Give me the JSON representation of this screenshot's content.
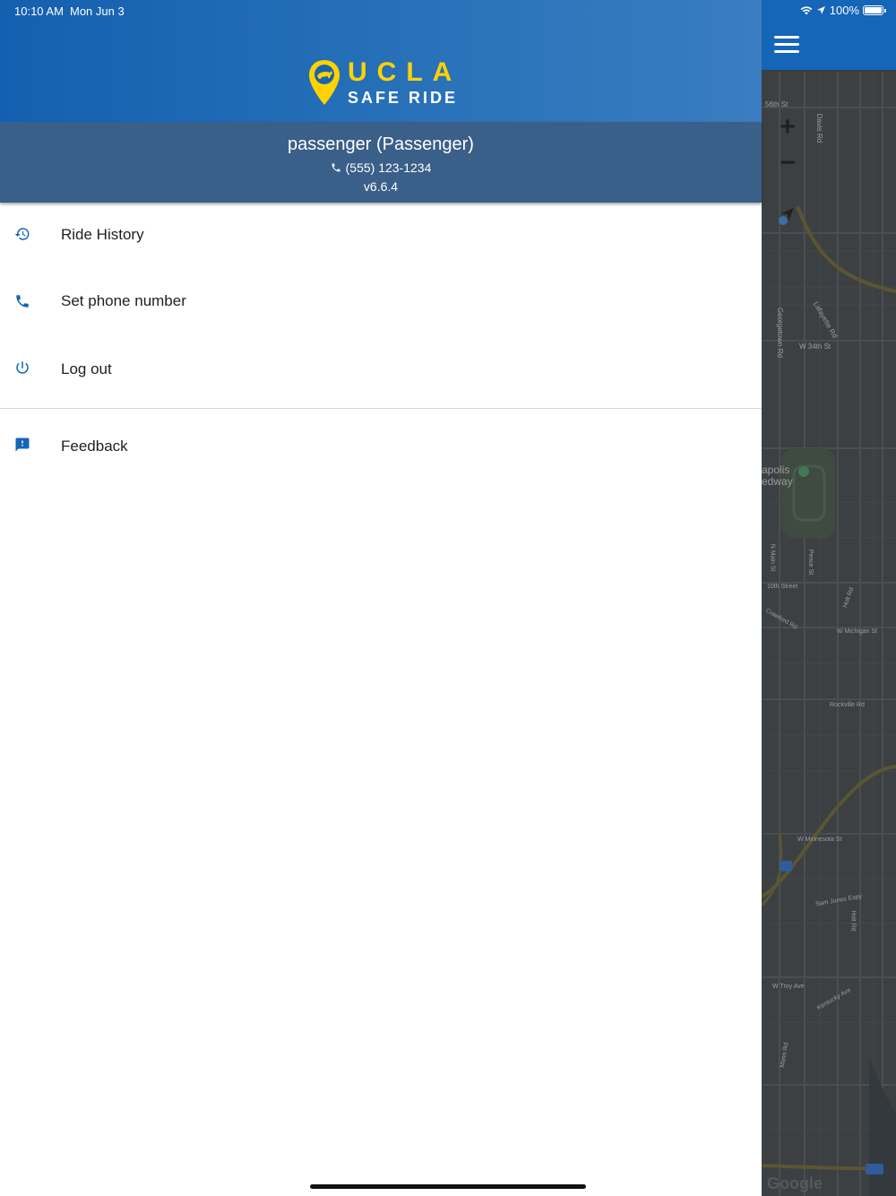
{
  "status_bar": {
    "time": "10:10 AM",
    "date": "Mon Jun 3",
    "battery": "100%"
  },
  "logo": {
    "title": "UCLA",
    "subtitle": "SAFE RIDE"
  },
  "user": {
    "name": "passenger (Passenger)",
    "phone": "(555) 123-1234",
    "version": "v6.6.4"
  },
  "menu": {
    "items": [
      {
        "label": "Ride History",
        "icon": "history-icon"
      },
      {
        "label": "Set phone number",
        "icon": "phone-icon"
      },
      {
        "label": "Log out",
        "icon": "power-icon"
      }
    ],
    "secondary": [
      {
        "label": "Feedback",
        "icon": "feedback-icon"
      }
    ]
  },
  "map": {
    "zoom_in": "+",
    "zoom_out": "−",
    "attribution": "Google",
    "labels": [
      "56th St",
      "Davis Rd",
      "Georgetown Rd",
      "Lafayette Rd",
      "W 34th St",
      "apolis",
      "edway",
      "N Main St",
      "Pence St",
      "10th Street",
      "Crawford Rd",
      "Holt Rd",
      "W Michigan St",
      "Rockville Rd",
      "W Minnesota St",
      "Sam Jones Expy",
      "Holt Rd",
      "W Troy Ave",
      "Kentucky Ave",
      "Mann Rd"
    ],
    "route_shields": [
      "70",
      "465"
    ]
  },
  "colors": {
    "header_blue": "#1460b0",
    "user_panel": "#3a5f89",
    "logo_gold": "#ffd200",
    "icon_blue": "#1565b8",
    "map_dark": "#3d4043"
  }
}
